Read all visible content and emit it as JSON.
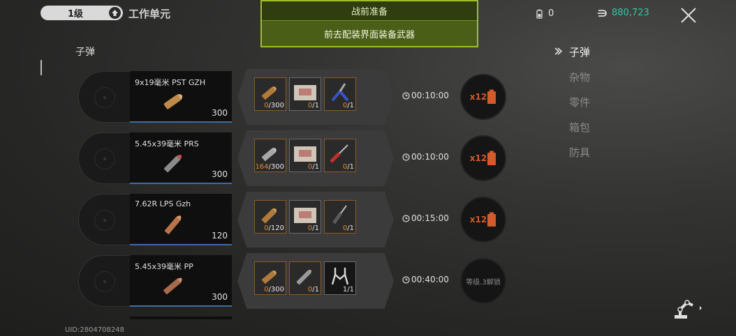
{
  "header": {
    "level": "1级",
    "station_title": "工作单元",
    "banner_title": "战前准备",
    "banner_subtitle": "前去配装界面装备武器",
    "battery_count": "0",
    "money": "880,723"
  },
  "section_label": "子弹",
  "categories": [
    {
      "label": "子弹",
      "active": true
    },
    {
      "label": "杂物",
      "active": false
    },
    {
      "label": "零件",
      "active": false
    },
    {
      "label": "箱包",
      "active": false
    },
    {
      "label": "防具",
      "active": false
    }
  ],
  "recipes": [
    {
      "name": "9x19毫米 PST GZH",
      "output": "300",
      "materials": [
        {
          "icon": "bullet-icon",
          "have": "0",
          "need": "300"
        },
        {
          "icon": "ammo-box-icon",
          "have": "0",
          "need": "1"
        },
        {
          "icon": "pliers-icon",
          "have": "0",
          "need": "1"
        }
      ],
      "time": "00:10:00",
      "action": "x12"
    },
    {
      "name": "5.45x39毫米  PRS",
      "output": "300",
      "materials": [
        {
          "icon": "bullet-icon",
          "have": "164",
          "need": "300"
        },
        {
          "icon": "ammo-box-icon",
          "have": "0",
          "need": "1"
        },
        {
          "icon": "screwdriver-icon",
          "have": "0",
          "need": "1"
        }
      ],
      "time": "00:10:00",
      "action": "x12"
    },
    {
      "name": "7.62R LPS Gzh",
      "output": "120",
      "materials": [
        {
          "icon": "bullet-icon",
          "have": "0",
          "need": "120"
        },
        {
          "icon": "ammo-box-icon",
          "have": "0",
          "need": "1"
        },
        {
          "icon": "screwdriver-icon",
          "have": "0",
          "need": "1"
        }
      ],
      "time": "00:15:00",
      "action": "x12"
    },
    {
      "name": "5.45x39毫米  PP",
      "output": "300",
      "materials": [
        {
          "icon": "bullet-icon",
          "have": "0",
          "need": "300"
        },
        {
          "icon": "bullet-icon",
          "have": "0",
          "need": "1"
        },
        {
          "icon": "multitool-icon",
          "have": "1",
          "need": "1"
        }
      ],
      "time": "00:40:00",
      "action": "等级.3解锁"
    }
  ],
  "uid": "UID:2804708248",
  "colors": {
    "banner_green": "#9fbf2a",
    "money": "#33c6a9",
    "missing": "#d98a3c",
    "x12": "#d35a2a",
    "product_underline": "#3a6fa6"
  }
}
